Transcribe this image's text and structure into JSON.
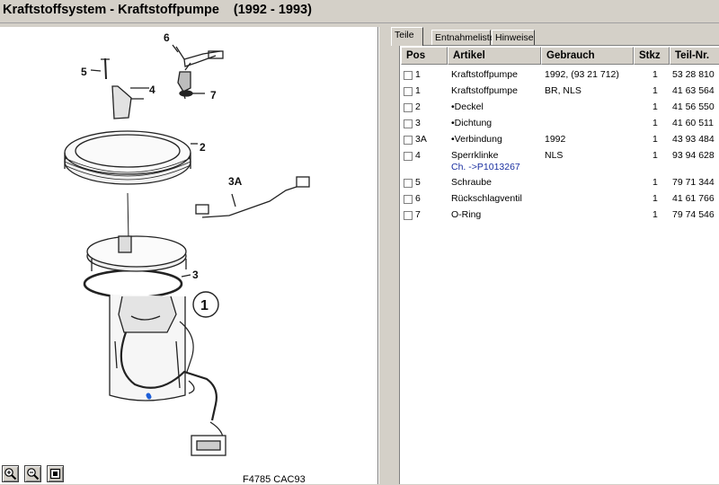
{
  "header": {
    "title": "Kraftstoffsystem - Kraftstoffpumpe",
    "years": "(1992 - 1993)"
  },
  "drawing": {
    "figure_code": "F4785 CAC93",
    "callouts": [
      "6",
      "5",
      "4",
      "2",
      "7",
      "3A",
      "3",
      "1"
    ],
    "zoom_tools": [
      "zoom-in-icon",
      "zoom-out-icon",
      "fit-to-window-icon"
    ]
  },
  "tabs": [
    {
      "label": "Teile",
      "active": true
    },
    {
      "label": "Entnahmeliste",
      "active": false
    },
    {
      "label": "Hinweise",
      "active": false
    }
  ],
  "table": {
    "columns": [
      "Pos",
      "Artikel",
      "Gebrauch",
      "Stkz",
      "Teil-Nr."
    ],
    "rows": [
      {
        "pos": "1",
        "artikel": "Kraftstoffpumpe",
        "gebrauch": "1992, (93 21 712)",
        "stkz": "1",
        "teilnr": "53 28 810",
        "note": ""
      },
      {
        "pos": "1",
        "artikel": "Kraftstoffpumpe",
        "gebrauch": "BR, NLS",
        "stkz": "1",
        "teilnr": "41 63 564",
        "note": ""
      },
      {
        "pos": "2",
        "artikel": "•Deckel",
        "gebrauch": "",
        "stkz": "1",
        "teilnr": "41 56 550",
        "note": ""
      },
      {
        "pos": "3",
        "artikel": "•Dichtung",
        "gebrauch": "",
        "stkz": "1",
        "teilnr": "41 60 511",
        "note": ""
      },
      {
        "pos": "3A",
        "artikel": "•Verbindung",
        "gebrauch": "1992",
        "stkz": "1",
        "teilnr": "43 93 484",
        "note": ""
      },
      {
        "pos": "4",
        "artikel": "Sperrklinke",
        "gebrauch": "NLS",
        "stkz": "1",
        "teilnr": "93 94 628",
        "note": "Ch. ->P1013267"
      },
      {
        "pos": "5",
        "artikel": "Schraube",
        "gebrauch": "",
        "stkz": "1",
        "teilnr": "79 71 344",
        "note": ""
      },
      {
        "pos": "6",
        "artikel": "Rückschlagventil",
        "gebrauch": "",
        "stkz": "1",
        "teilnr": "41 61 766",
        "note": ""
      },
      {
        "pos": "7",
        "artikel": "O-Ring",
        "gebrauch": "",
        "stkz": "1",
        "teilnr": "79 74 546",
        "note": ""
      }
    ]
  },
  "colors": {
    "window_bg": "#d4d0c8",
    "grid_bg": "#ffffff",
    "chassis_link": "#1a2fa0",
    "marker_dot": "#1e5fd8"
  }
}
